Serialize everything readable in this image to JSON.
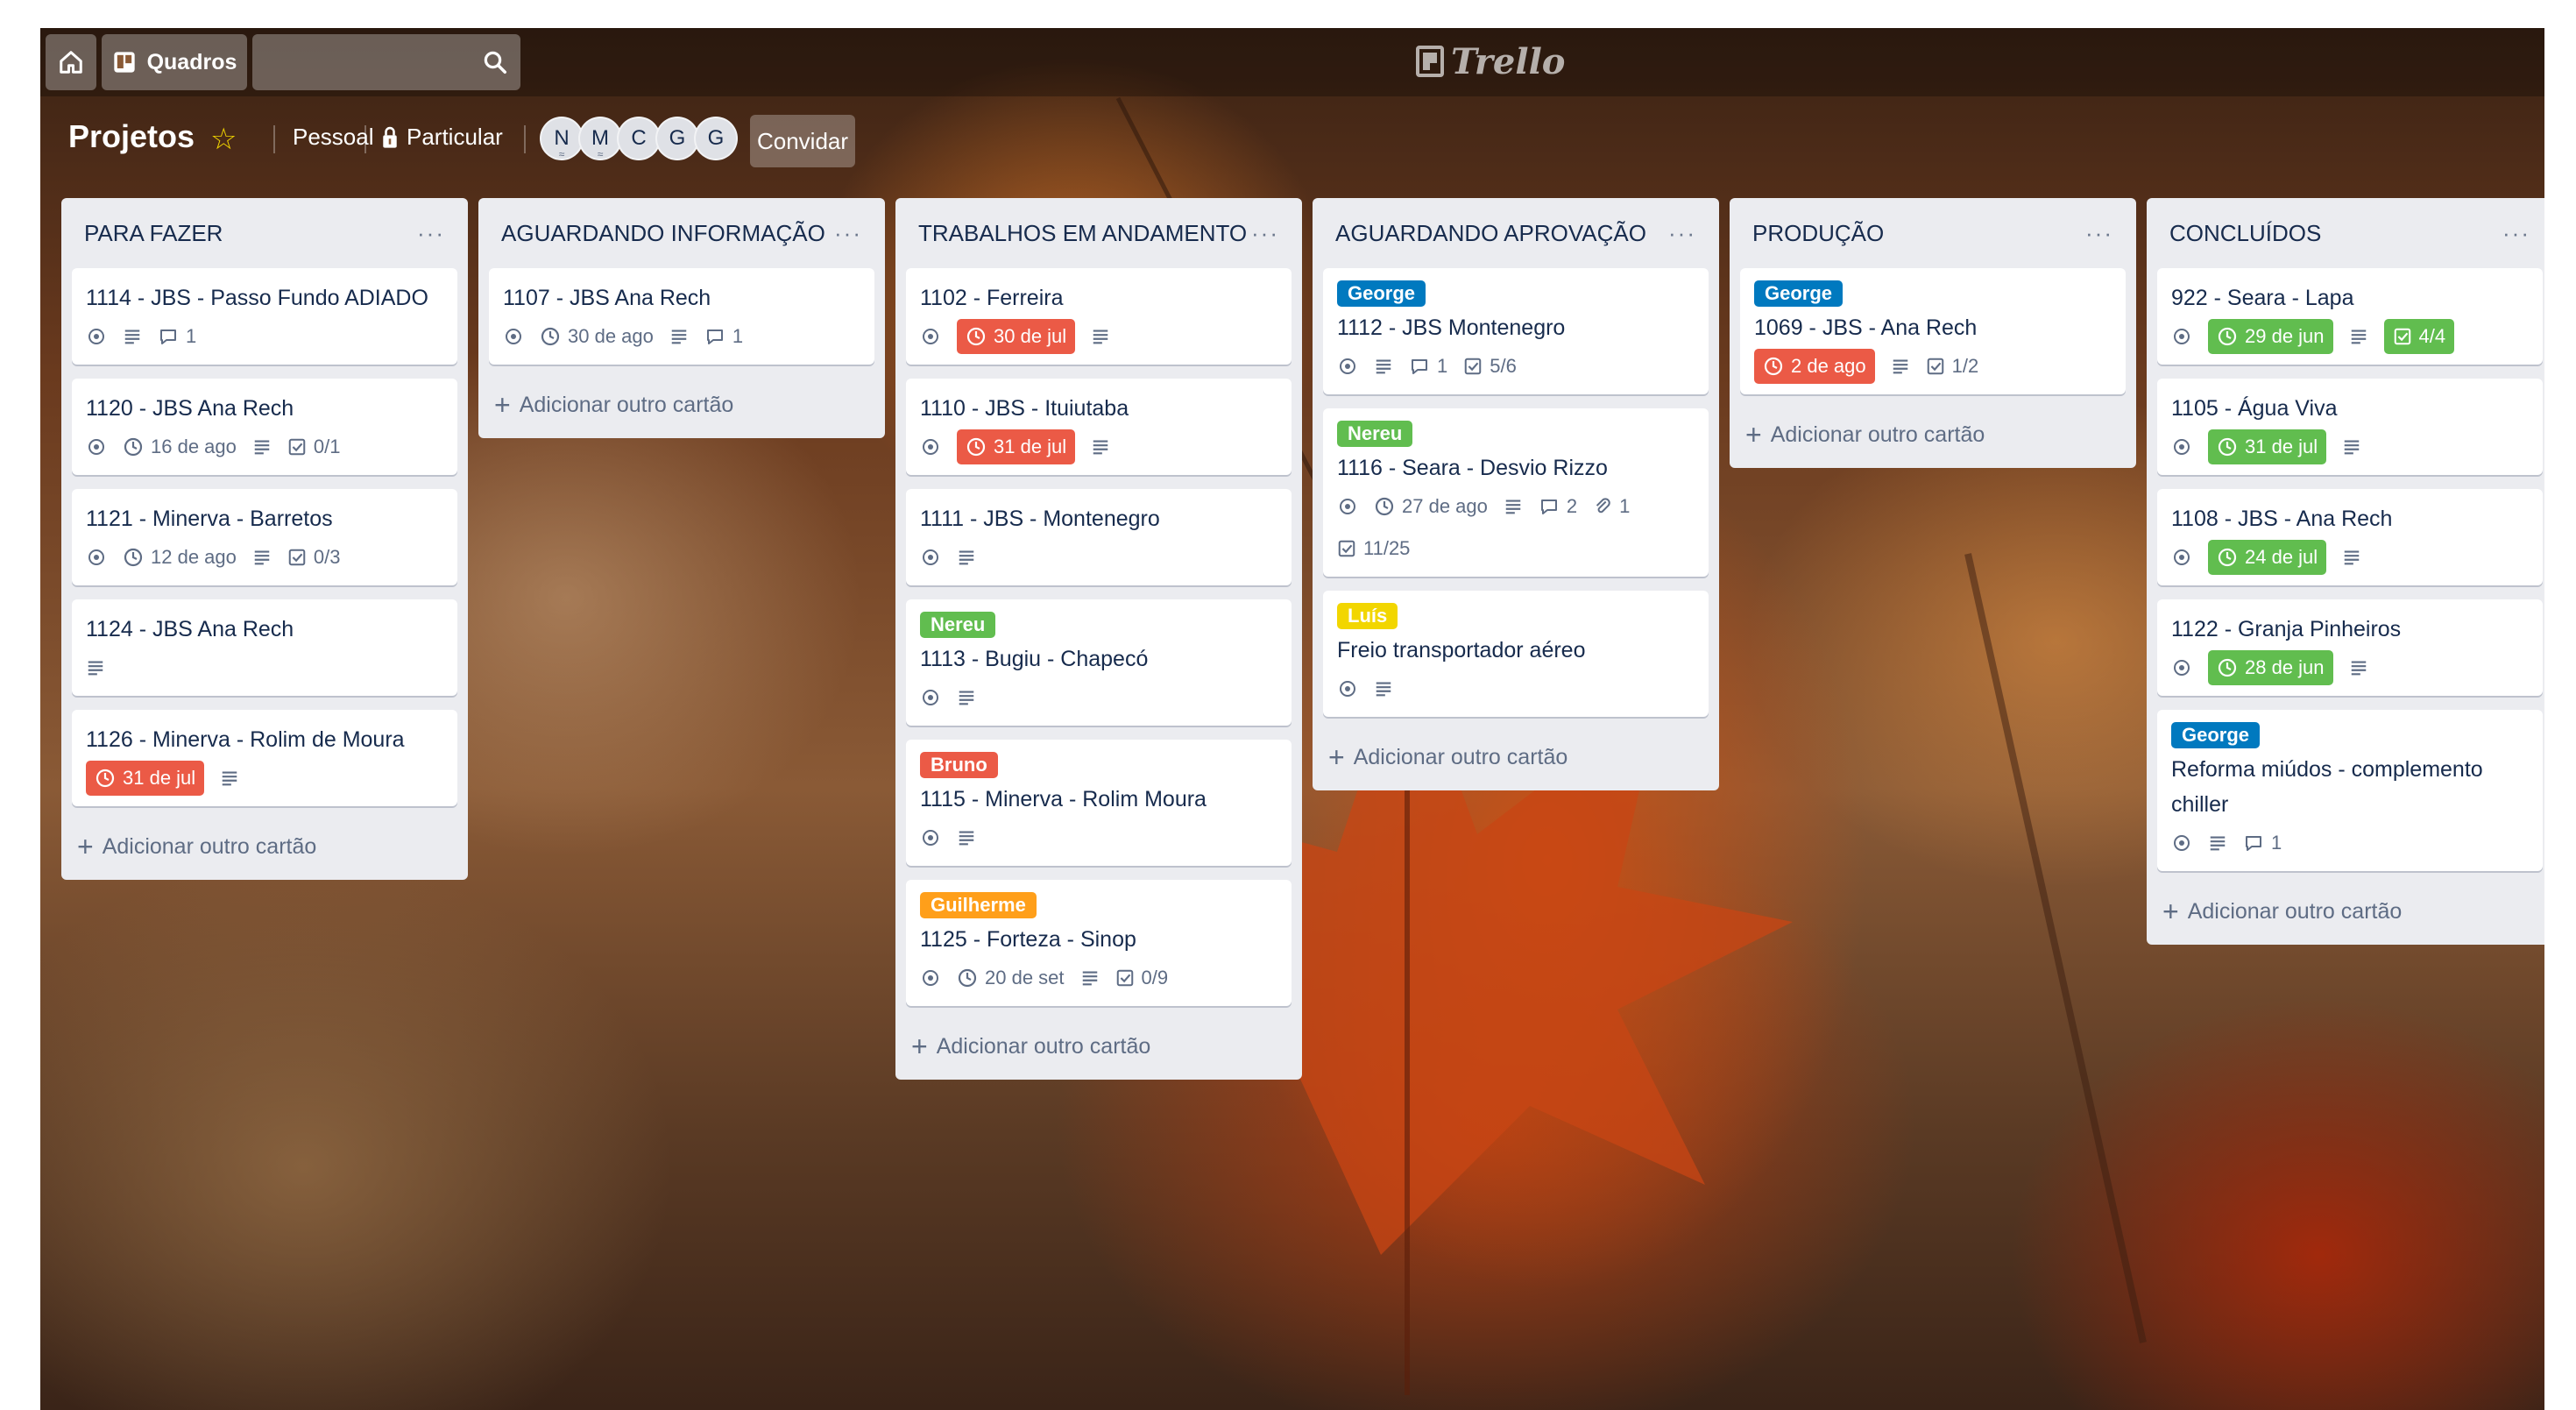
{
  "header": {
    "boards_label": "Quadros",
    "logo_text": "Trello"
  },
  "board": {
    "title": "Projetos",
    "team": "Pessoal",
    "visibility": "Particular",
    "members": [
      {
        "initial": "N",
        "sub": "≈"
      },
      {
        "initial": "M",
        "sub": "≈"
      },
      {
        "initial": "C",
        "sub": ""
      },
      {
        "initial": "G",
        "sub": ""
      },
      {
        "initial": "G",
        "sub": ""
      }
    ],
    "invite_label": "Convidar"
  },
  "add_card_label": "Adicionar outro cartão",
  "colors": {
    "due_red": "#eb5a46",
    "due_green": "#61bd4f",
    "label_blue": "#0079bf",
    "label_green": "#61bd4f",
    "label_yellow": "#f2d600",
    "label_red": "#eb5a46",
    "label_orange": "#ff9f1a"
  },
  "lists": [
    {
      "title": "PARA FAZER",
      "cards": [
        {
          "title": "1114 - JBS - Passo Fundo ADIADO",
          "watch": true,
          "desc": true,
          "comments": "1"
        },
        {
          "title": "1120 - JBS Ana Rech",
          "watch": true,
          "due": "16 de ago",
          "desc": true,
          "checklist": "0/1"
        },
        {
          "title": "1121 - Minerva - Barretos",
          "watch": true,
          "due": "12 de ago",
          "desc": true,
          "checklist": "0/3"
        },
        {
          "title": "1124 - JBS Ana Rech",
          "desc": true
        },
        {
          "title": "1126 - Minerva - Rolim de Moura",
          "due": "31 de jul",
          "due_color": "red",
          "desc": true
        }
      ]
    },
    {
      "title": "AGUARDANDO INFORMAÇÃO",
      "cards": [
        {
          "title": "1107 - JBS Ana Rech",
          "watch": true,
          "due": "30 de ago",
          "desc": true,
          "comments": "1"
        }
      ]
    },
    {
      "title": "TRABALHOS EM ANDAMENTO",
      "cards": [
        {
          "title": "1102 - Ferreira",
          "watch": true,
          "due": "30 de jul",
          "due_color": "red",
          "desc": true
        },
        {
          "title": "1110 - JBS - Ituiutaba",
          "watch": true,
          "due": "31 de jul",
          "due_color": "red",
          "desc": true
        },
        {
          "title": "1111 - JBS - Montenegro",
          "watch": true,
          "desc": true
        },
        {
          "label": "Nereu",
          "label_color": "green",
          "title": "1113 - Bugiu - Chapecó",
          "watch": true,
          "desc": true
        },
        {
          "label": "Bruno",
          "label_color": "red",
          "title": "1115 - Minerva - Rolim Moura",
          "watch": true,
          "desc": true
        },
        {
          "label": "Guilherme",
          "label_color": "orange",
          "title": "1125 - Forteza - Sinop",
          "watch": true,
          "due": "20 de set",
          "desc": true,
          "checklist": "0/9"
        }
      ]
    },
    {
      "title": "AGUARDANDO APROVAÇÃO",
      "cards": [
        {
          "label": "George",
          "label_color": "blue",
          "title": "1112 - JBS Montenegro",
          "watch": true,
          "desc": true,
          "comments": "1",
          "checklist": "5/6"
        },
        {
          "label": "Nereu",
          "label_color": "green",
          "title": "1116 - Seara - Desvio Rizzo",
          "watch": true,
          "due": "27 de ago",
          "desc": true,
          "comments": "2",
          "attachments": "1",
          "checklist2": "11/25"
        },
        {
          "label": "Luís",
          "label_color": "yellow",
          "title": "Freio transportador aéreo",
          "watch": true,
          "desc": true
        }
      ]
    },
    {
      "title": "PRODUÇÃO",
      "cards": [
        {
          "label": "George",
          "label_color": "blue",
          "title": "1069 - JBS - Ana Rech",
          "due": "2 de ago",
          "due_color": "red",
          "desc": true,
          "checklist": "1/2"
        }
      ]
    },
    {
      "title": "CONCLUÍDOS",
      "cards": [
        {
          "title": "922 - Seara - Lapa",
          "watch": true,
          "due": "29 de jun",
          "due_color": "green",
          "desc": true,
          "checklist": "4/4",
          "checklist_color": "green"
        },
        {
          "title": "1105 - Água Viva",
          "watch": true,
          "due": "31 de jul",
          "due_color": "green",
          "desc": true
        },
        {
          "title": "1108 - JBS - Ana Rech",
          "watch": true,
          "due": "24 de jul",
          "due_color": "green",
          "desc": true
        },
        {
          "title": "1122 - Granja Pinheiros",
          "watch": true,
          "due": "28 de jun",
          "due_color": "green",
          "desc": true
        },
        {
          "label": "George",
          "label_color": "blue",
          "title": "Reforma miúdos - complemento chiller",
          "watch": true,
          "desc": true,
          "comments": "1"
        }
      ]
    }
  ]
}
